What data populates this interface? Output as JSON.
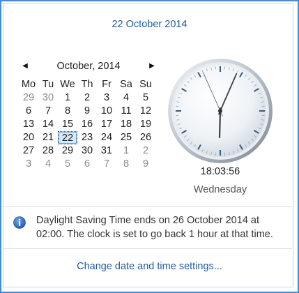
{
  "header": {
    "date_link": "22 October 2014"
  },
  "calendar": {
    "prev_arrow": "◀",
    "next_arrow": "▶",
    "month_title": "October, 2014",
    "weekdays": [
      "Mo",
      "Tu",
      "We",
      "Th",
      "Fr",
      "Sa",
      "Su"
    ],
    "weeks": [
      [
        "29",
        "30",
        "1",
        "2",
        "3",
        "4",
        "5"
      ],
      [
        "6",
        "7",
        "8",
        "9",
        "10",
        "11",
        "12"
      ],
      [
        "13",
        "14",
        "15",
        "16",
        "17",
        "18",
        "19"
      ],
      [
        "20",
        "21",
        "22",
        "23",
        "24",
        "25",
        "26"
      ],
      [
        "27",
        "28",
        "29",
        "30",
        "31",
        "1",
        "2"
      ],
      [
        "3",
        "4",
        "5",
        "6",
        "7",
        "8",
        "9"
      ]
    ],
    "selected_day": "22"
  },
  "clock": {
    "hours": 18,
    "minutes": 3,
    "seconds": 56,
    "time_text": "18:03:56",
    "day_text": "Wednesday"
  },
  "notice": {
    "icon": "info-icon",
    "text": "Daylight Saving Time ends on 26 October 2014 at 02:00. The clock is set to go back 1 hour at that time."
  },
  "footer": {
    "settings_link": "Change date and time settings..."
  },
  "colors": {
    "accent": "#1a5fa8",
    "frame_border": "#3d8ee0",
    "muted_day": "#8a8a8a",
    "info_icon": "#2a63b8"
  }
}
